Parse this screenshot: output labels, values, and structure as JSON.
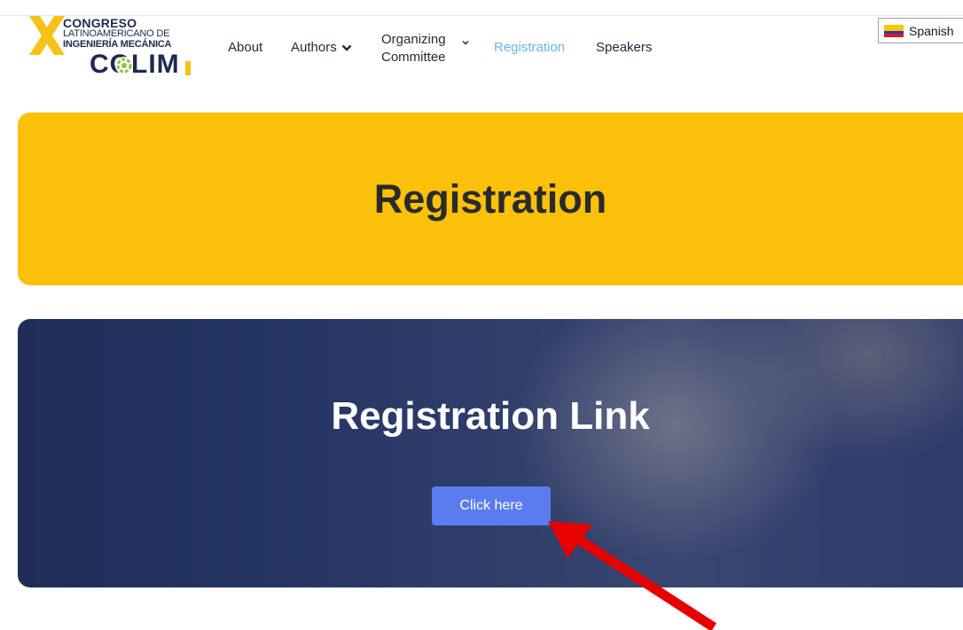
{
  "logo": {
    "line1": "CONGRESO",
    "line2": "LATINOAMERICANO DE",
    "line3": "INGENIERÍA MECÁNICA",
    "wordmark": "COLIM",
    "mark": "X"
  },
  "nav": {
    "about": "About",
    "authors": "Authors",
    "organizing_line1": "Organizing",
    "organizing_line2": "Committee",
    "registration": "Registration",
    "speakers": "Speakers"
  },
  "language": {
    "label": "Spanish",
    "flag_icon": "colombia-flag-icon"
  },
  "banner": {
    "title": "Registration"
  },
  "card": {
    "title": "Registration Link",
    "button_label": "Click here"
  },
  "colors": {
    "accent_yellow": "#fbc10a",
    "active_nav": "#6cb4e8",
    "button_blue": "#5b7cf0",
    "card_navy": "#243463",
    "arrow_red": "#e60000"
  }
}
